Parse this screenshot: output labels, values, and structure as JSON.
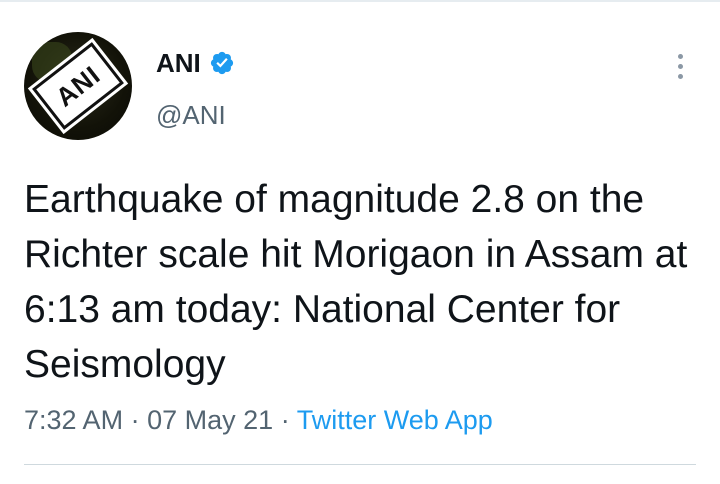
{
  "tweet": {
    "display_name": "ANI",
    "handle": "@ANI",
    "avatar_logo_text": "ANI",
    "verified": true,
    "text": "Earthquake of magnitude 2.8 on the Richter scale hit Morigaon in Assam at 6:13 am today: National Center for Seismology",
    "time": "7:32 AM",
    "separator": "·",
    "date": "07 May 21",
    "source": "Twitter Web App"
  },
  "colors": {
    "verified_badge": "#1d9bf0",
    "link": "#1d9bf0",
    "secondary_text": "#536471",
    "primary_text": "#0f1419"
  },
  "icons": {
    "verified": "verified-badge-icon",
    "more": "more-options-icon"
  }
}
